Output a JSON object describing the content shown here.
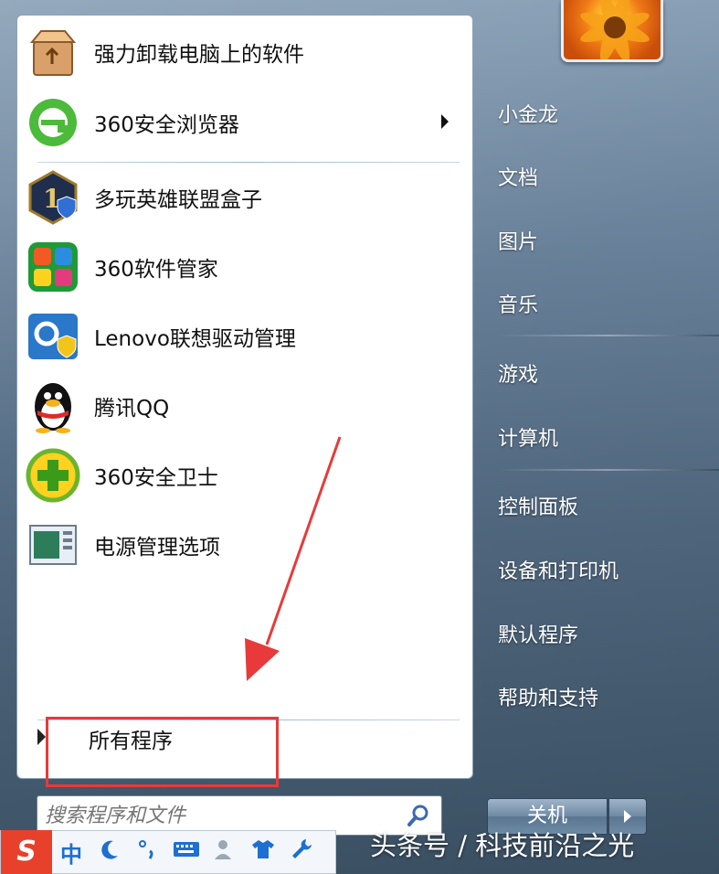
{
  "programs": [
    {
      "label": "强力卸载电脑上的软件",
      "icon": "uninstall-box-icon"
    },
    {
      "label": "360安全浏览器",
      "icon": "browser-e-icon",
      "has_submenu": true
    },
    {
      "label": "多玩英雄联盟盒子",
      "icon": "lol-box-icon"
    },
    {
      "label": "360软件管家",
      "icon": "software-manager-icon"
    },
    {
      "label": "Lenovo联想驱动管理",
      "icon": "driver-manager-icon"
    },
    {
      "label": "腾讯QQ",
      "icon": "qq-penguin-icon"
    },
    {
      "label": "360安全卫士",
      "icon": "security-guard-icon"
    },
    {
      "label": "电源管理选项",
      "icon": "power-options-icon"
    }
  ],
  "all_programs": "所有程序",
  "search": {
    "placeholder": "搜索程序和文件"
  },
  "right_links": {
    "user": "小金龙",
    "documents": "文档",
    "pictures": "图片",
    "music": "音乐",
    "games": "游戏",
    "computer": "计算机",
    "control_panel": "控制面板",
    "devices": "设备和打印机",
    "default_programs": "默认程序",
    "help": "帮助和支持"
  },
  "shutdown": "关机",
  "ime": {
    "logo": "S",
    "mode": "中"
  },
  "watermark": "头条号 / 科技前沿之光",
  "colors": {
    "annotation": "#e83a3a",
    "sidebar_bg": "#647d96"
  }
}
